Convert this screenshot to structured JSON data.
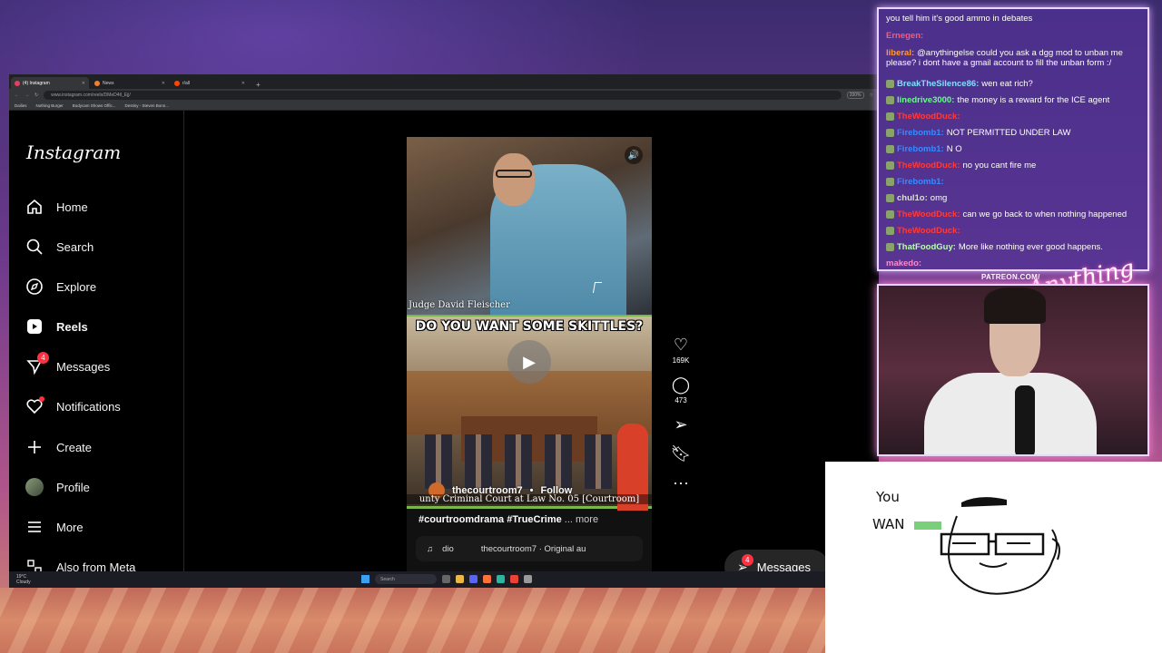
{
  "browser": {
    "tabs": [
      {
        "label": "(4) Instagram",
        "active": true
      },
      {
        "label": "News",
        "active": false
      },
      {
        "label": "r/all",
        "active": false
      }
    ],
    "new_tab": "+",
    "url": "www.instagram.com/reels/DMeD4tl_Ejj/",
    "zoom": "200%",
    "bookmarks": [
      "Dailies",
      "Nothing Burger",
      "Bodycam Shows Offic...",
      "Destiny - Steven Bonn..."
    ]
  },
  "instagram": {
    "logo": "Instagram",
    "nav": [
      {
        "label": "Home",
        "icon": "home-icon"
      },
      {
        "label": "Search",
        "icon": "search-icon"
      },
      {
        "label": "Explore",
        "icon": "compass-icon"
      },
      {
        "label": "Reels",
        "icon": "reels-icon"
      },
      {
        "label": "Messages",
        "icon": "messenger-icon",
        "badge": "4"
      },
      {
        "label": "Notifications",
        "icon": "heart-icon"
      },
      {
        "label": "Create",
        "icon": "plus-icon"
      },
      {
        "label": "Profile",
        "icon": "avatar"
      },
      {
        "label": "More",
        "icon": "menu-icon"
      },
      {
        "label": "Also from Meta",
        "icon": "meta-icon"
      }
    ],
    "reel": {
      "judge_caption": "Judge David Fleischer",
      "overlay_title": "DO YOU WANT SOME SKITTLES?",
      "account": "thecourtroom7",
      "follow": "Follow",
      "court_caption": "unty Criminal Court at Law No. 05 [Courtroom]",
      "description": "#courtroomdrama #TrueCrime",
      "more": "... more",
      "audio_user": "dio",
      "audio_track": "thecourtroom7 · Original au"
    },
    "actions": {
      "likes": "169K",
      "comments": "473"
    },
    "messages_pill": {
      "label": "Messages",
      "badge": "4"
    }
  },
  "taskbar": {
    "weather_temp": "19°C",
    "weather_desc": "Cloudy",
    "search": "Search"
  },
  "chat": [
    {
      "user": "",
      "text": "you tell him it's good ammo in debates",
      "color": "#ffffff"
    },
    {
      "user": "Ernegen:",
      "text": "",
      "color": "#ff5a6a"
    },
    {
      "user": "liberal:",
      "text": "@anythingelse could you ask a dgg mod to unban me please? i dont have a gmail account to fill the unban form :/",
      "color": "#ff9b3a"
    },
    {
      "user": "BreakTheSilence86:",
      "text": "wen eat rich?",
      "color": "#7fe0ff"
    },
    {
      "user": "linedrive3000:",
      "text": "the money is a reward for the ICE agent",
      "color": "#66ff88"
    },
    {
      "user": "TheWoodDuck:",
      "text": "",
      "color": "#ff3a3a"
    },
    {
      "user": "Firebomb1:",
      "text": "NOT PERMITTED UNDER LAW",
      "color": "#3a8aff"
    },
    {
      "user": "Firebomb1:",
      "text": "N O",
      "color": "#3a8aff"
    },
    {
      "user": "TheWoodDuck:",
      "text": "no you cant fire me",
      "color": "#ff3a3a"
    },
    {
      "user": "Firebomb1:",
      "text": "",
      "color": "#3a8aff"
    },
    {
      "user": "chul1o:",
      "text": "omg",
      "color": "#dddddd"
    },
    {
      "user": "TheWoodDuck:",
      "text": "can we go back to when nothing happened",
      "color": "#ff3a3a"
    },
    {
      "user": "TheWoodDuck:",
      "text": "",
      "color": "#ff3a3a"
    },
    {
      "user": "ThatFoodGuy:",
      "text": "More like nothing ever good happens.",
      "color": "#b8ffb0"
    },
    {
      "user": "makedo:",
      "text": "",
      "color": "#ff8ad0"
    }
  ],
  "stream": {
    "patreon": "PATREON.COM/",
    "logo": "Anything Else?"
  },
  "drawing": {
    "line1": "You",
    "line2": "WAN"
  }
}
